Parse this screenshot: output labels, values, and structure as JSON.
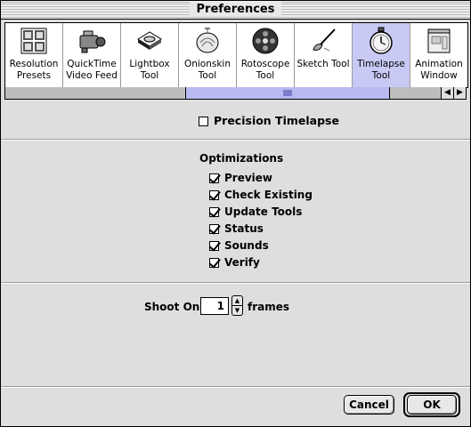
{
  "window": {
    "title": "Preferences"
  },
  "toolbar": {
    "items": [
      {
        "line1": "Resolution",
        "line2": "Presets",
        "icon": "resolution-presets-icon"
      },
      {
        "line1": "QuickTime",
        "line2": "Video Feed",
        "icon": "video-camera-icon"
      },
      {
        "line1": "Lightbox",
        "line2": "Tool",
        "icon": "lightbox-icon"
      },
      {
        "line1": "Onionskin",
        "line2": "Tool",
        "icon": "onion-icon"
      },
      {
        "line1": "Rotoscope",
        "line2": "Tool",
        "icon": "film-reel-icon"
      },
      {
        "line1": "Sketch Tool",
        "line2": "",
        "icon": "brush-icon"
      },
      {
        "line1": "Timelapse",
        "line2": "Tool",
        "icon": "stopwatch-icon"
      },
      {
        "line1": "Animation",
        "line2": "Window",
        "icon": "window-icon"
      }
    ],
    "selected": "Timelapse Tool"
  },
  "scrollbar": {
    "left_arrow": "◀",
    "right_arrow": "▶"
  },
  "precision": {
    "label": "Precision Timelapse",
    "checked": false
  },
  "optimizations": {
    "heading": "Optimizations",
    "options": [
      {
        "label": "Preview",
        "checked": true
      },
      {
        "label": "Check Existing",
        "checked": true
      },
      {
        "label": "Update Tools",
        "checked": true
      },
      {
        "label": "Status",
        "checked": true
      },
      {
        "label": "Sounds",
        "checked": true
      },
      {
        "label": "Verify",
        "checked": true
      }
    ]
  },
  "shoot": {
    "label": "Shoot On:",
    "value": "1",
    "unit": "frames",
    "up": "▲",
    "down": "▼"
  },
  "buttons": {
    "cancel": "Cancel",
    "ok": "OK"
  },
  "colors": {
    "selected_tool": "#c9c9f5",
    "scroll_thumb": "#b9b9f2",
    "window_bg": "#dedede"
  }
}
